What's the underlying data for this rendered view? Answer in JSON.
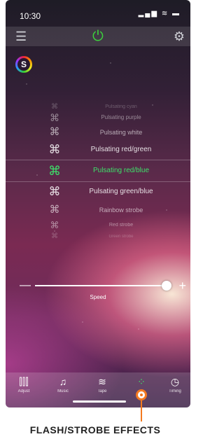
{
  "status_bar": {
    "time": "10:30",
    "icons": "▂▄▆ ≋ ▬"
  },
  "toolbar": {
    "menu_icon": "☰",
    "power_icon": "⏻",
    "gear_icon": "⚙"
  },
  "logo": {
    "letter": "S"
  },
  "effects": {
    "icon": "⌘",
    "items": [
      {
        "label": "Pulsating cyan"
      },
      {
        "label": "Pulsating purple"
      },
      {
        "label": "Pulsating white"
      },
      {
        "label": "Pulsating red/green"
      },
      {
        "label": "Pulsating red/blue",
        "selected": true
      },
      {
        "label": "Pulsating green/blue"
      },
      {
        "label": "Rainbow strobe"
      },
      {
        "label": "Red strobe"
      },
      {
        "label": "Green strobe"
      }
    ]
  },
  "speed": {
    "minus": "—",
    "plus": "+",
    "label": "Speed",
    "value_fraction": 0.97
  },
  "tabs": [
    {
      "label": "Adjust",
      "icon": "⫿⫿⫿"
    },
    {
      "label": "Music",
      "icon": "♫"
    },
    {
      "label": "Tape",
      "icon": "≋"
    },
    {
      "label": "",
      "icon": "⁘",
      "active": true
    },
    {
      "label": "Timing",
      "icon": "◷"
    }
  ],
  "caption": "FLASH/STROBE EFFECTS",
  "colors": {
    "accent_green": "#3ee06a",
    "callout_orange": "#f47a20"
  }
}
